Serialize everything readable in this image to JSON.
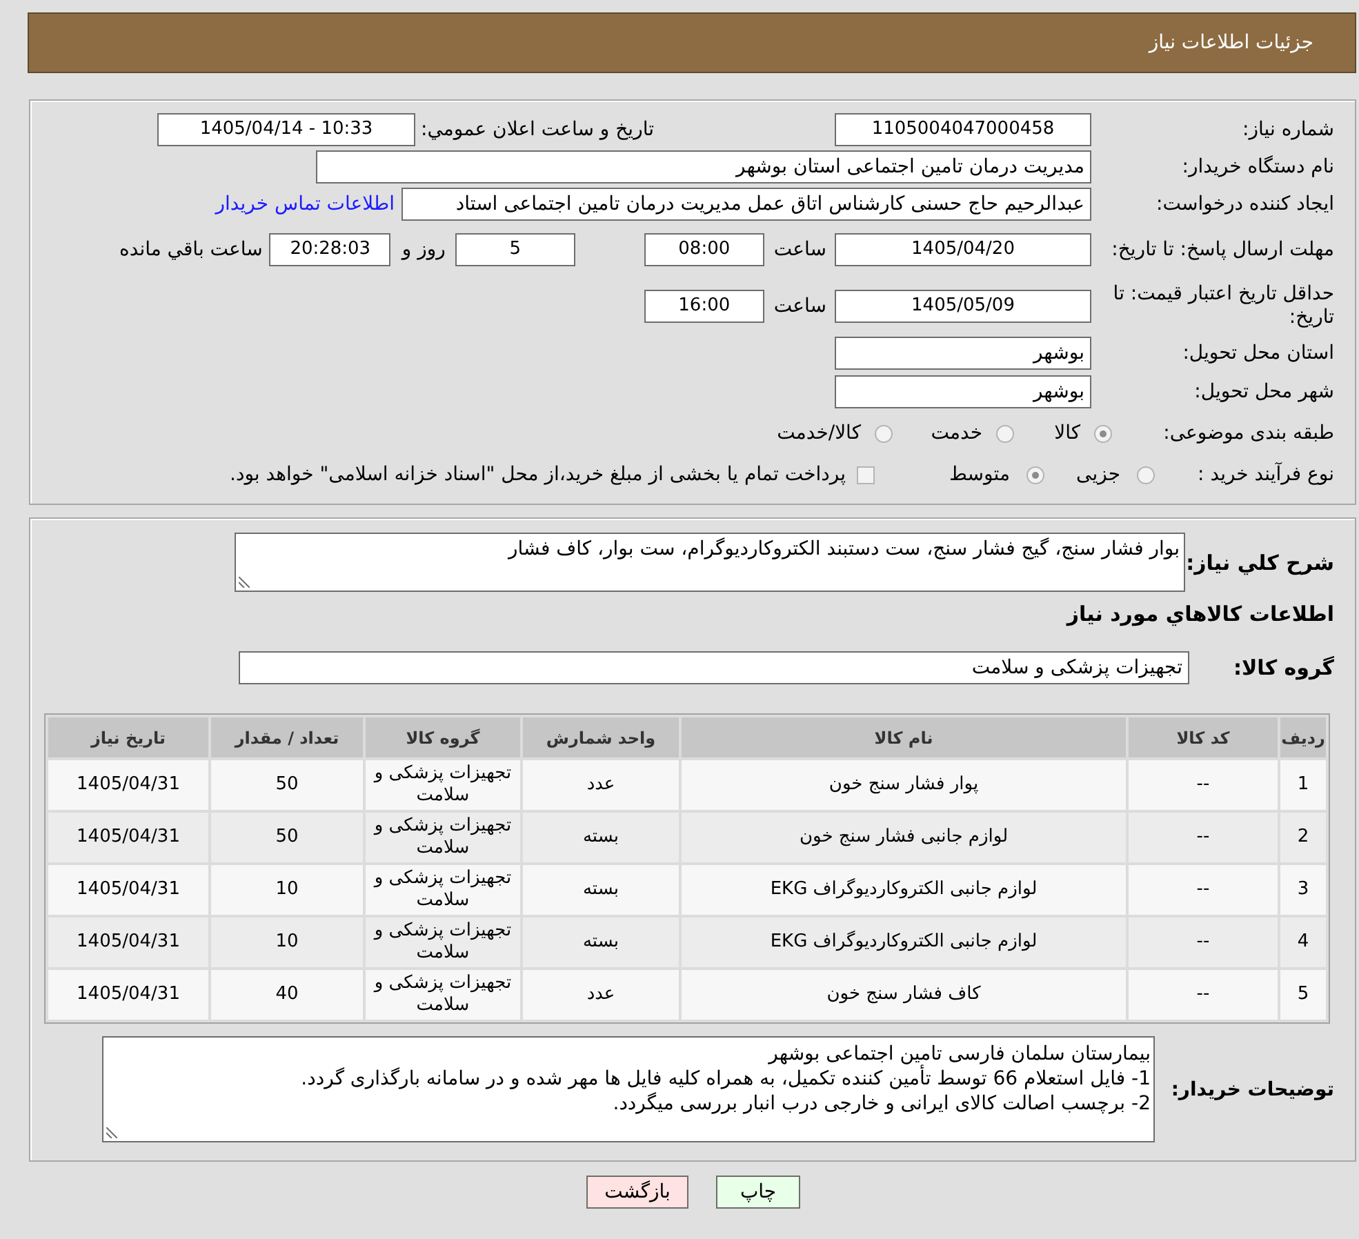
{
  "header": {
    "title": "جزئیات اطلاعات نیاز"
  },
  "details": {
    "need_number": {
      "label": "شماره نیاز:",
      "value": "1105004047000458"
    },
    "announcement": {
      "label": "تاریخ و ساعت اعلان عمومي:",
      "value": "1405/04/14 - 10:33"
    },
    "buyer_organization": {
      "label": "نام دستگاه خریدار:",
      "value": "مدیریت درمان تامین اجتماعی استان بوشهر"
    },
    "requester": {
      "label": "ایجاد کننده درخواست:",
      "value": "عبدالرحیم حاج حسنی کارشناس اتاق عمل مدیریت درمان تامین اجتماعی استاد",
      "contact_link": "اطلاعات تماس خریدار"
    },
    "response_deadline": {
      "label": "مهلت ارسال پاسخ: تا تاریخ:",
      "date": "1405/04/20",
      "time_label": "ساعت",
      "time": "08:00",
      "days": "5",
      "days_label": "روز و",
      "remaining": "20:28:03",
      "remaining_label": "ساعت باقي مانده"
    },
    "price_validity": {
      "label": "حداقل تاریخ اعتبار قیمت: تا تاریخ:",
      "date": "1405/05/09",
      "time_label": "ساعت",
      "time": "16:00"
    },
    "delivery_province": {
      "label": "استان محل تحویل:",
      "value": "بوشهر"
    },
    "delivery_city": {
      "label": "شهر محل تحویل:",
      "value": "بوشهر"
    },
    "subject_category": {
      "label": "طبقه بندی موضوعی:",
      "options": [
        {
          "label": "کالا",
          "selected": true
        },
        {
          "label": "خدمت",
          "selected": false
        },
        {
          "label": "کالا/خدمت",
          "selected": false
        }
      ]
    },
    "purchase_process": {
      "label": "نوع فرآیند خرید :",
      "options": [
        {
          "label": "جزیی",
          "selected": false
        },
        {
          "label": "متوسط",
          "selected": true
        }
      ],
      "payment_option": {
        "label": "پرداخت تمام یا بخشی از مبلغ خرید،از محل \"اسناد خزانه اسلامی\" خواهد بود.",
        "checked": false
      }
    }
  },
  "needs": {
    "description": {
      "label": "شرح کلي نیاز:",
      "value": "بوار فشار سنج، گیج فشار سنج، ست دستبند الکتروکاردیوگرام، ست بوار، کاف فشار"
    },
    "items_title": "اطلاعات کالاهاي مورد نیاز",
    "goods_group": {
      "label": "گروه کالا:",
      "value": "تجهیزات پزشکی و سلامت"
    },
    "table": {
      "columns": [
        "ردیف",
        "کد کالا",
        "نام کالا",
        "واحد شمارش",
        "گروه کالا",
        "تعداد / مقدار",
        "تاریخ نیاز"
      ],
      "rows": [
        [
          "1",
          "--",
          "پوار فشار سنج خون",
          "عدد",
          "تجهیزات پزشکی و سلامت",
          "50",
          "1405/04/31"
        ],
        [
          "2",
          "--",
          "لوازم جانبی فشار سنج خون",
          "بسته",
          "تجهیزات پزشکی و سلامت",
          "50",
          "1405/04/31"
        ],
        [
          "3",
          "--",
          "لوازم جانبی الکتروکاردیوگراف EKG",
          "بسته",
          "تجهیزات پزشکی و سلامت",
          "10",
          "1405/04/31"
        ],
        [
          "4",
          "--",
          "لوازم جانبی الکتروکاردیوگراف EKG",
          "بسته",
          "تجهیزات پزشکی و سلامت",
          "10",
          "1405/04/31"
        ],
        [
          "5",
          "--",
          "کاف فشار سنج خون",
          "عدد",
          "تجهیزات پزشکی و سلامت",
          "40",
          "1405/04/31"
        ]
      ]
    },
    "buyer_notes": {
      "label": "توضیحات خریدار:",
      "value": "بیمارستان سلمان فارسی تامین اجتماعی بوشهر\n1- فایل استعلام 66 توسط تأمین کننده تکمیل، به همراه کلیه فایل ها مهر شده و در سامانه بارگذاری گردد.\n2- برچسب اصالت کالای ایرانی و خارجی درب انبار بررسی میگردد."
    }
  },
  "buttons": [
    {
      "label": "چاپ",
      "kind": "print"
    },
    {
      "label": "بازگشت",
      "kind": "back"
    }
  ]
}
